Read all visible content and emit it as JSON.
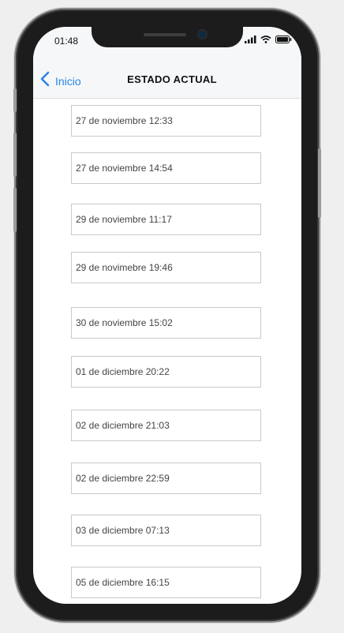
{
  "status_bar": {
    "time": "01:48",
    "icons": [
      "signal-icon",
      "wifi-icon",
      "battery-icon"
    ]
  },
  "nav": {
    "back_label": "Inicio",
    "back_icon": "chevron-left-icon",
    "title": "ESTADO ACTUAL"
  },
  "colors": {
    "accent": "#2a84e6",
    "item_border": "#c9c9c9",
    "nav_background": "#f6f7f8"
  },
  "entries": [
    "27 de noviembre 12:33",
    "27 de noviembre 14:54",
    "29 de noviembre 11:17",
    "29 de novimebre 19:46",
    "30 de noviembre 15:02",
    "01 de diciembre 20:22",
    "02 de diciembre 21:03",
    "02 de diciembre 22:59",
    "03 de diciembre 07:13",
    "05 de diciembre 16:15"
  ]
}
